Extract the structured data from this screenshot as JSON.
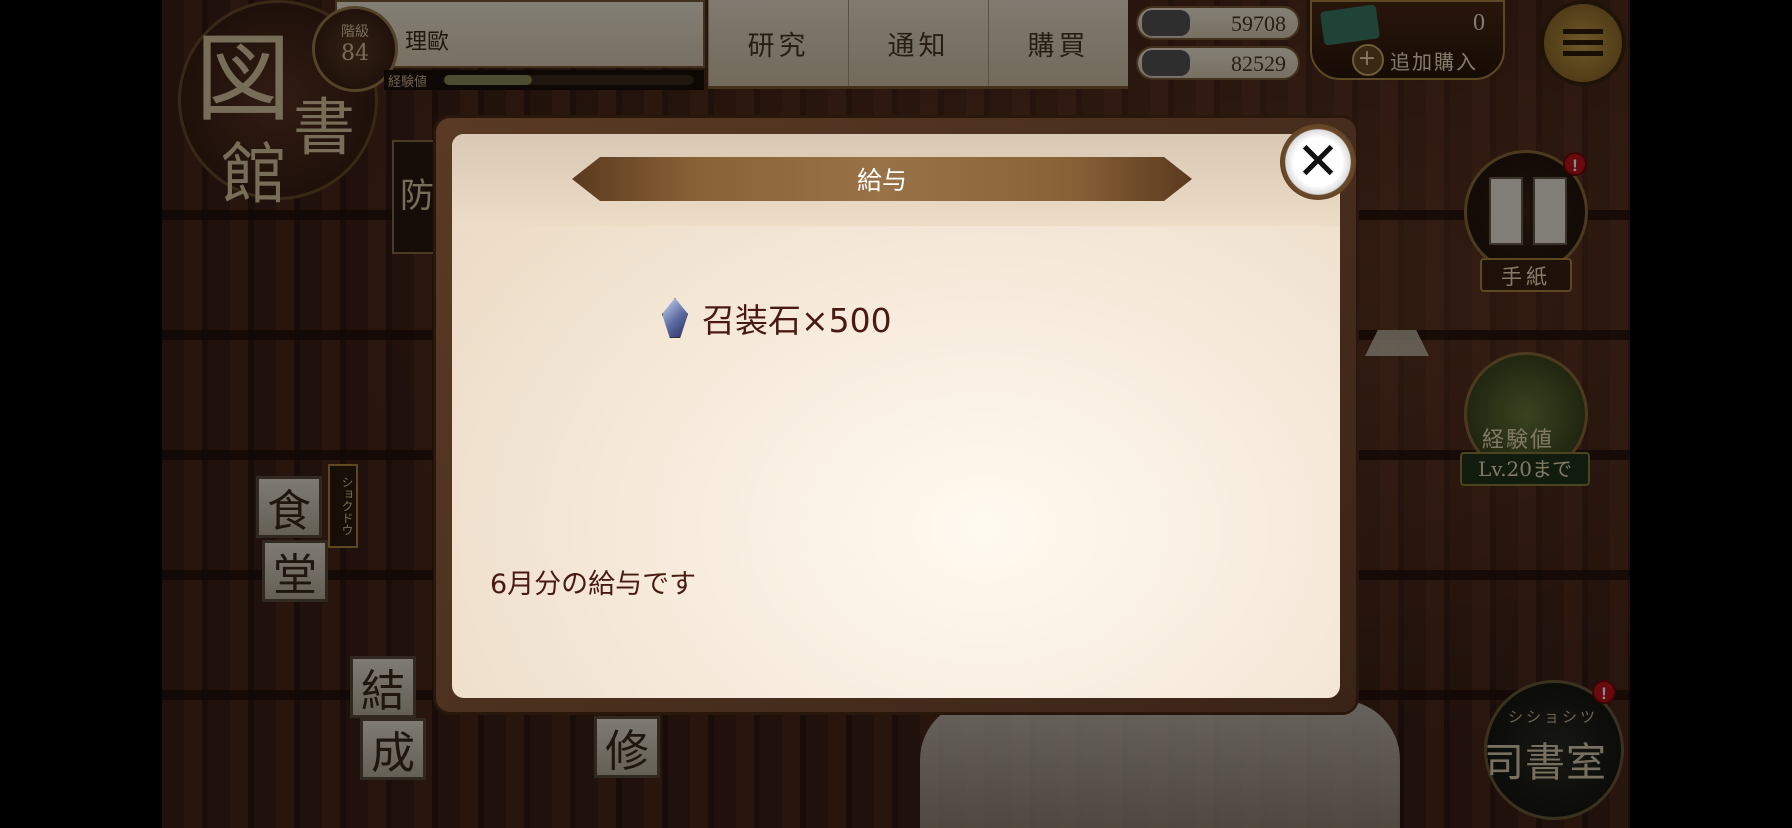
{
  "header": {
    "rank_label": "階級",
    "rank_level": "84",
    "player_name": "理歐",
    "exp_label": "経験値",
    "exp_progress": 0.35,
    "nav": [
      "研究",
      "通知",
      "購買"
    ],
    "ink": "59708",
    "rice": "82529",
    "gems": "0",
    "add_purchase": "追加購入"
  },
  "left": {
    "library_chars": [
      "図",
      "書",
      "館"
    ],
    "cut_label": "防",
    "cafeteria_kana": "ショクドウ",
    "cafeteria_chars": [
      "食",
      "堂"
    ],
    "formation_chars": [
      "結",
      "成"
    ],
    "repair_char": "修"
  },
  "right": {
    "letters_label": "手紙",
    "letters_badge": "!",
    "exp_label": "経験値",
    "exp_goal": "Lv.20まで",
    "office_kana": "シショシツ",
    "office_name": "司書室",
    "office_badge": "!"
  },
  "dialog": {
    "title": "給与",
    "reward": "召装石×500",
    "message": "6月分の給与です",
    "close_symbol": "✕"
  },
  "colors": {
    "title_text": "#ffffff",
    "body_text": "#4a1a12",
    "badge": "#c0141a"
  }
}
